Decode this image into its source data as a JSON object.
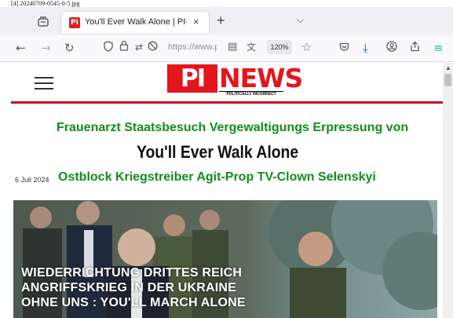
{
  "caption": "[4] 20240709-0545-0-5.jpg",
  "browser": {
    "tab": {
      "favicon_text": "PI",
      "title": "You'll Ever Walk Alone | PI-NEW",
      "close": "×"
    },
    "new_tab": "+",
    "tab_list": "⌵",
    "url": "https://www.p",
    "zoom": "120%"
  },
  "site": {
    "logo_pi": "PI",
    "logo_news": "NEWS",
    "logo_tagline": "POLITICALLY INCORRECT",
    "tags_line1": "Frauenarzt Staatsbesuch Vergewaltigungs Erpressung von",
    "headline": "You'll Ever Walk Alone",
    "date": "6 Juli 2024",
    "tags_line2": "Ostblock Kriegstreiber  Agit-Prop TV-Clown Selenskyi"
  },
  "image_overlay": {
    "line1": "WIEDERRICHTUNG DRITTES REICH",
    "line2": "ANGRIFFSKRIEG IN DER UKRAINE",
    "line3": "OHNE UNS : YOU'LL MARCH ALONE"
  },
  "colors": {
    "brand_red": "#e4151b",
    "tag_green": "#108e1a"
  }
}
